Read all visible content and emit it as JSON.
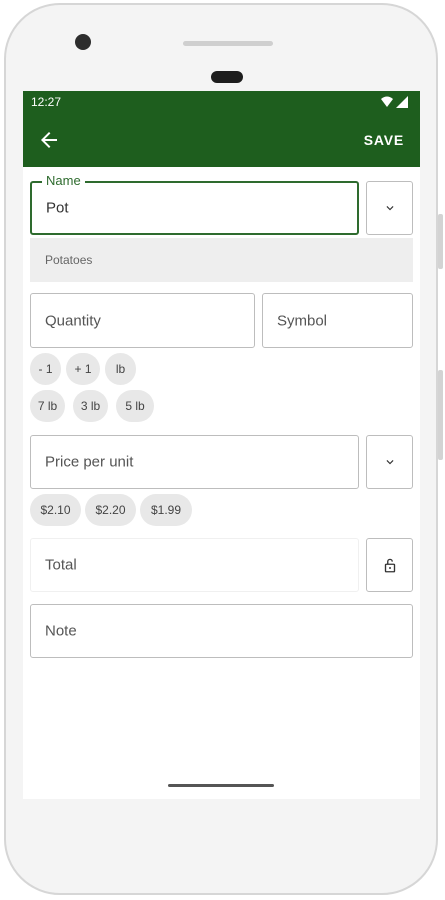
{
  "status_bar": {
    "time": "12:27"
  },
  "toolbar": {
    "save_label": "SAVE"
  },
  "name_field": {
    "label": "Name",
    "value": "Pot"
  },
  "suggestion": {
    "text": "Potatoes"
  },
  "quantity_field": {
    "placeholder": "Quantity"
  },
  "symbol_field": {
    "placeholder": "Symbol"
  },
  "quantity_chips": [
    "- 1",
    "+ 1",
    "lb"
  ],
  "unit_chips": [
    "7 lb",
    "3 lb",
    "5 lb"
  ],
  "price_field": {
    "placeholder": "Price per unit"
  },
  "price_chips": [
    "$2.10",
    "$2.20",
    "$1.99"
  ],
  "total_field": {
    "placeholder": "Total"
  },
  "note_field": {
    "placeholder": "Note"
  },
  "colors": {
    "primary": "#1e5e1e",
    "accent": "#2e6b2e",
    "chip": "#e8e8e8"
  }
}
